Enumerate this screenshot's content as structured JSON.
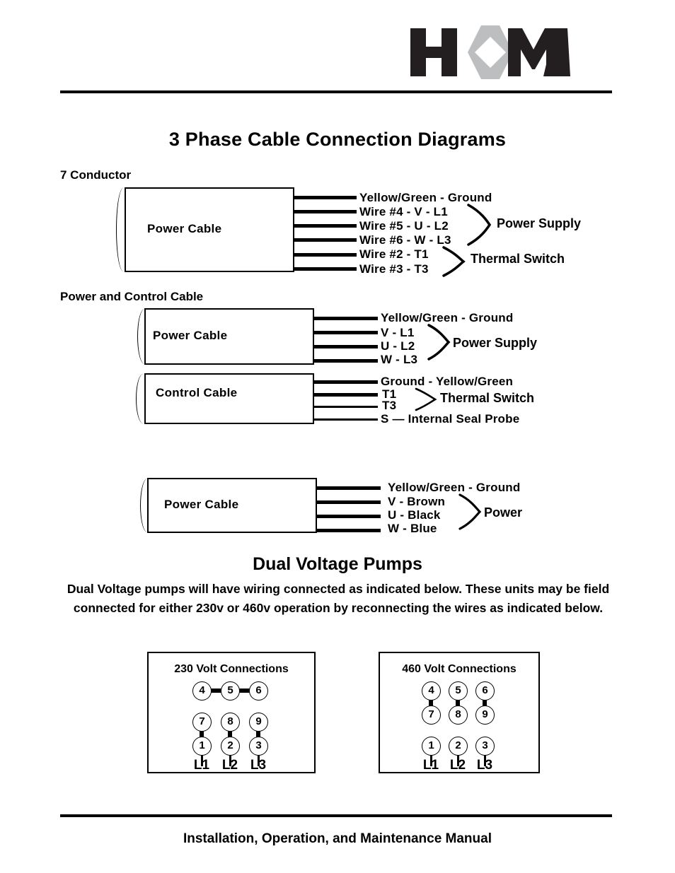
{
  "document": {
    "title": "3 Phase Cable Connection Diagrams",
    "footer": "Installation, Operation, and Maintenance Manual",
    "logo_alt": "HOMA"
  },
  "sections": {
    "seven_conductor": {
      "label": "7 Conductor",
      "box_label": "Power  Cable",
      "wires": [
        "Yellow/Green - Ground",
        "Wire #4 - V - L1",
        "Wire #5 - U - L2",
        "Wire #6 - W - L3",
        "Wire #2 - T1",
        "Wire #3 - T3"
      ],
      "groups": [
        "Power Supply",
        "Thermal Switch"
      ]
    },
    "power_and_control": {
      "label": "Power and Control Cable",
      "power_box_label": "Power  Cable",
      "power_wires": [
        "Yellow/Green - Ground",
        "V - L1",
        "U - L2",
        "W - L3"
      ],
      "power_group": "Power Supply",
      "control_box_label": "Control Cable",
      "control_wires": [
        "Ground - Yellow/Green",
        "T1",
        "T3",
        "S — Internal Seal Probe"
      ],
      "control_group": "Thermal Switch"
    },
    "colored_power_cable": {
      "box_label": "Power  Cable",
      "wires": [
        "Yellow/Green - Ground",
        "V - Brown",
        "U - Black",
        "W - Blue"
      ],
      "group": "Power"
    }
  },
  "dual_voltage": {
    "title": "Dual Voltage Pumps",
    "body": "Dual Voltage pumps will have wiring connected as indicated below.  These units may be field connected for either 230v or 460v operation by reconnecting the wires as indicated below.",
    "panel_230": {
      "title": "230 Volt Connections",
      "nodes_row1": [
        "4",
        "5",
        "6"
      ],
      "nodes_row2": [
        "7",
        "8",
        "9"
      ],
      "nodes_row3": [
        "1",
        "2",
        "3"
      ],
      "phases": [
        "L1",
        "L2",
        "L3"
      ]
    },
    "panel_460": {
      "title": "460 Volt Connections",
      "nodes_row1": [
        "4",
        "5",
        "6"
      ],
      "nodes_row2": [
        "7",
        "8",
        "9"
      ],
      "nodes_row3": [
        "1",
        "2",
        "3"
      ],
      "phases": [
        "L1",
        "L2",
        "L3"
      ]
    }
  },
  "colors": {
    "ink": "#000000",
    "logo_dark": "#231f20",
    "logo_gray": "#bcbec0",
    "paper": "#ffffff"
  }
}
